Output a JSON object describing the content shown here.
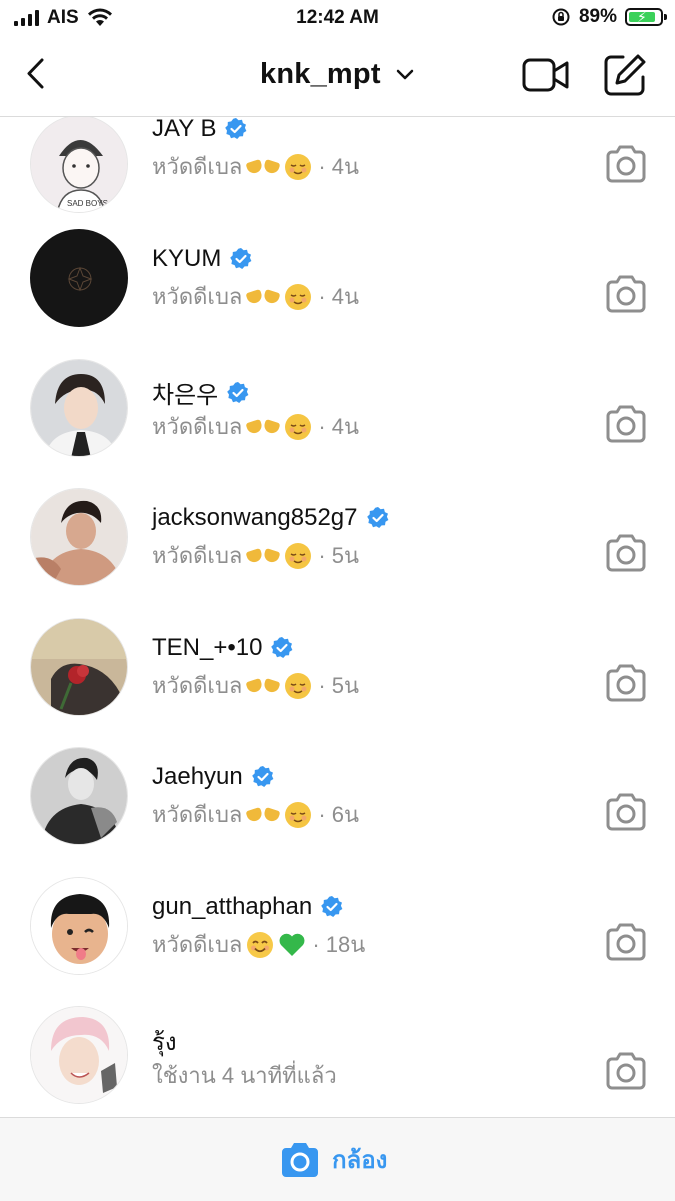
{
  "status_bar": {
    "carrier": "AIS",
    "time": "12:42 AM",
    "battery_percent": "89%",
    "battery_level": 0.89
  },
  "header": {
    "title": "knk_mpt"
  },
  "colors": {
    "verified_blue": "#3897f0",
    "secondary_text": "#8e8e8e",
    "divider": "#dbdbdb",
    "battery_green": "#3bd15a"
  },
  "conversations": [
    {
      "name": "JAY B",
      "verified": true,
      "message": "หวัดดีเบล",
      "emojis": [
        "hands",
        "relieved-face"
      ],
      "time": "4น"
    },
    {
      "name": "KYUM",
      "verified": true,
      "message": "หวัดดีเบล",
      "emojis": [
        "hands",
        "relieved-face"
      ],
      "time": "4น"
    },
    {
      "name": "차은우",
      "verified": true,
      "message": "หวัดดีเบล",
      "emojis": [
        "hands",
        "relieved-face"
      ],
      "time": "4น"
    },
    {
      "name": "jacksonwang852g7",
      "verified": true,
      "message": "หวัดดีเบล",
      "emojis": [
        "hands",
        "relieved-face"
      ],
      "time": "5น"
    },
    {
      "name": "TEN_+•10",
      "verified": true,
      "message": "หวัดดีเบล",
      "emojis": [
        "hands",
        "relieved-face"
      ],
      "time": "5น"
    },
    {
      "name": "Jaehyun",
      "verified": true,
      "message": "หวัดดีเบล",
      "emojis": [
        "hands",
        "relieved-face"
      ],
      "time": "6น"
    },
    {
      "name": "gun_atthaphan",
      "verified": true,
      "message": "หวัดดีเบล",
      "emojis": [
        "smiling-face",
        "green-heart"
      ],
      "time": "18น"
    },
    {
      "name": "รุ้ง",
      "verified": false,
      "message": "ใช้งาน 4 นาทีที่แล้ว",
      "emojis": [],
      "time": ""
    }
  ],
  "bottom_bar": {
    "camera_label": "กล้อง"
  }
}
